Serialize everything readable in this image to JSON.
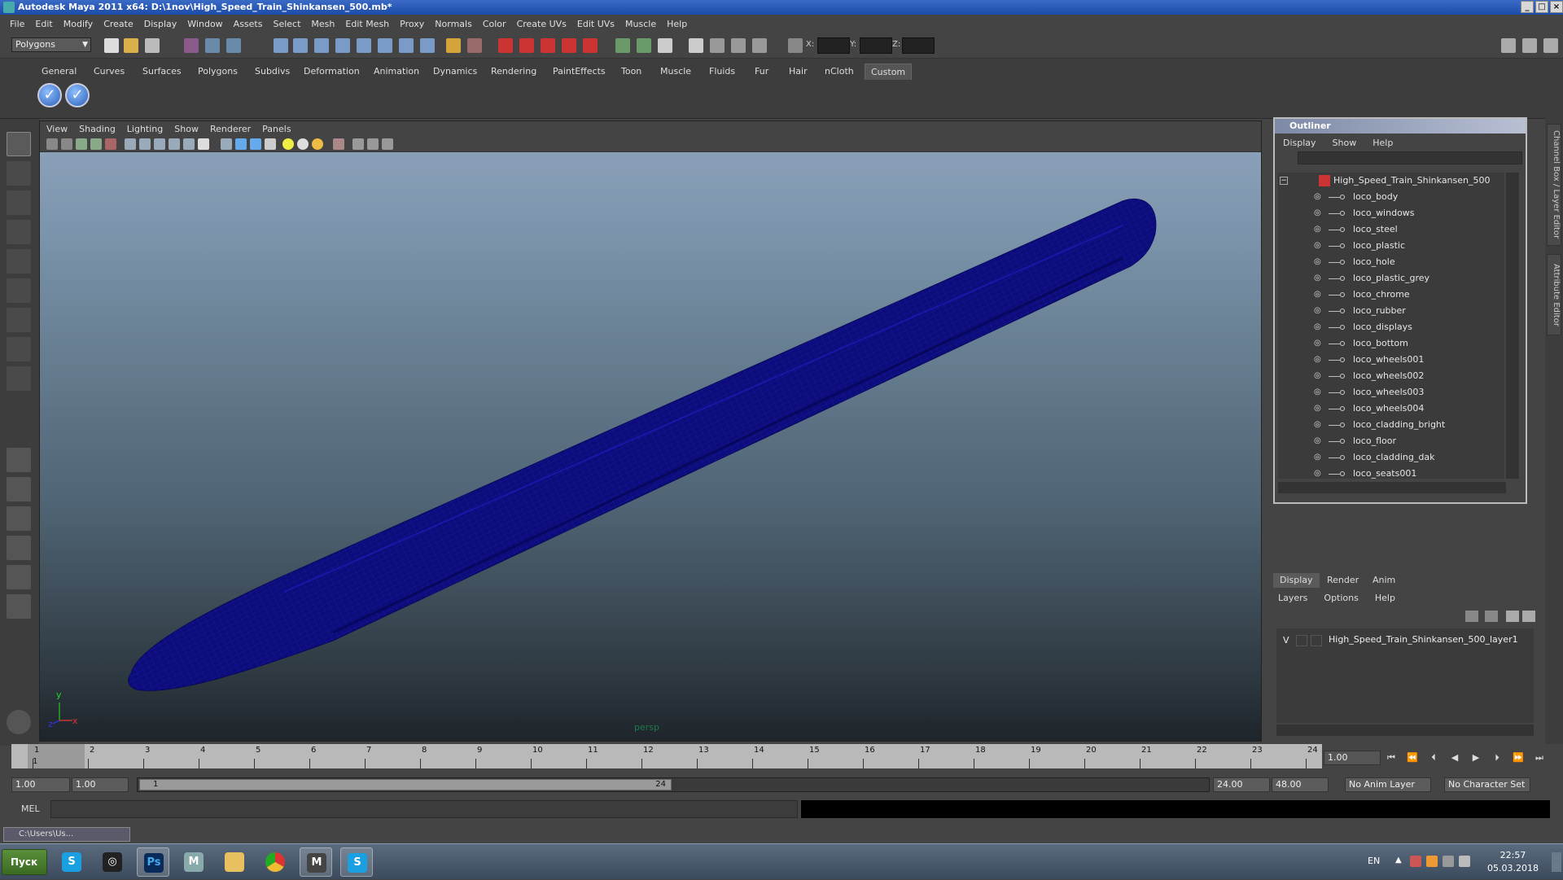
{
  "window": {
    "title": "Autodesk Maya 2011 x64: D:\\1nov\\High_Speed_Train_Shinkansen_500.mb*",
    "controls": [
      "_",
      "□",
      "×"
    ]
  },
  "menubar": [
    "File",
    "Edit",
    "Modify",
    "Create",
    "Display",
    "Window",
    "Assets",
    "Select",
    "Mesh",
    "Edit Mesh",
    "Proxy",
    "Normals",
    "Color",
    "Create UVs",
    "Edit UVs",
    "Muscle",
    "Help"
  ],
  "statusline": {
    "mode": "Polygons",
    "x_label": "X:",
    "y_label": "Y:",
    "z_label": "Z:"
  },
  "shelf": {
    "tabs": [
      "General",
      "Curves",
      "Surfaces",
      "Polygons",
      "Subdivs",
      "Deformation",
      "Animation",
      "Dynamics",
      "Rendering",
      "PaintEffects",
      "Toon",
      "Muscle",
      "Fluids",
      "Fur",
      "Hair",
      "nCloth",
      "Custom"
    ],
    "active_tab": "Custom"
  },
  "viewport": {
    "menu": [
      "View",
      "Shading",
      "Lighting",
      "Show",
      "Renderer",
      "Panels"
    ],
    "camera": "persp",
    "axis_y": "y",
    "axis_x": "x",
    "axis_z": "z",
    "wire_color": "#0c0c7a"
  },
  "outliner": {
    "title": "Outliner",
    "menu": [
      "Display",
      "Show",
      "Help"
    ],
    "root": "High_Speed_Train_Shinkansen_500",
    "items": [
      "loco_body",
      "loco_windows",
      "loco_steel",
      "loco_plastic",
      "loco_hole",
      "loco_plastic_grey",
      "loco_chrome",
      "loco_rubber",
      "loco_displays",
      "loco_bottom",
      "loco_wheels001",
      "loco_wheels002",
      "loco_wheels003",
      "loco_wheels004",
      "loco_cladding_bright",
      "loco_floor",
      "loco_cladding_dak",
      "loco_seats001"
    ]
  },
  "layers": {
    "tabs": [
      "Display",
      "Render",
      "Anim"
    ],
    "active_tab": "Display",
    "menu": [
      "Layers",
      "Options",
      "Help"
    ],
    "visibility": "V",
    "layer_name": "High_Speed_Train_Shinkansen_500_layer1"
  },
  "side_tabs": [
    "Channel Box / Layer Editor",
    "Attribute Editor"
  ],
  "timeslider": {
    "ticks": [
      "1",
      "2",
      "3",
      "4",
      "5",
      "6",
      "7",
      "8",
      "9",
      "10",
      "11",
      "12",
      "13",
      "14",
      "15",
      "16",
      "17",
      "18",
      "19",
      "20",
      "21",
      "22",
      "23",
      "24"
    ],
    "current_marker": "1",
    "current_frame": "1.00"
  },
  "range": {
    "start": "1.00",
    "playback_start": "1.00",
    "handle_start": "1",
    "handle_end": "24",
    "playback_end": "24.00",
    "end": "48.00",
    "anim_layer": "No Anim Layer",
    "character_set": "No Character Set"
  },
  "cmdline": {
    "label": "MEL"
  },
  "minimized": {
    "title": "C:\\Users\\Us..."
  },
  "taskbar": {
    "start": "Пуск",
    "apps": [
      "Skype",
      "Steam",
      "Photoshop",
      "Maya Dev",
      "Explorer",
      "Chrome",
      "Maya",
      "Skype"
    ],
    "lang": "EN",
    "time": "22:57",
    "date": "05.03.2018"
  }
}
